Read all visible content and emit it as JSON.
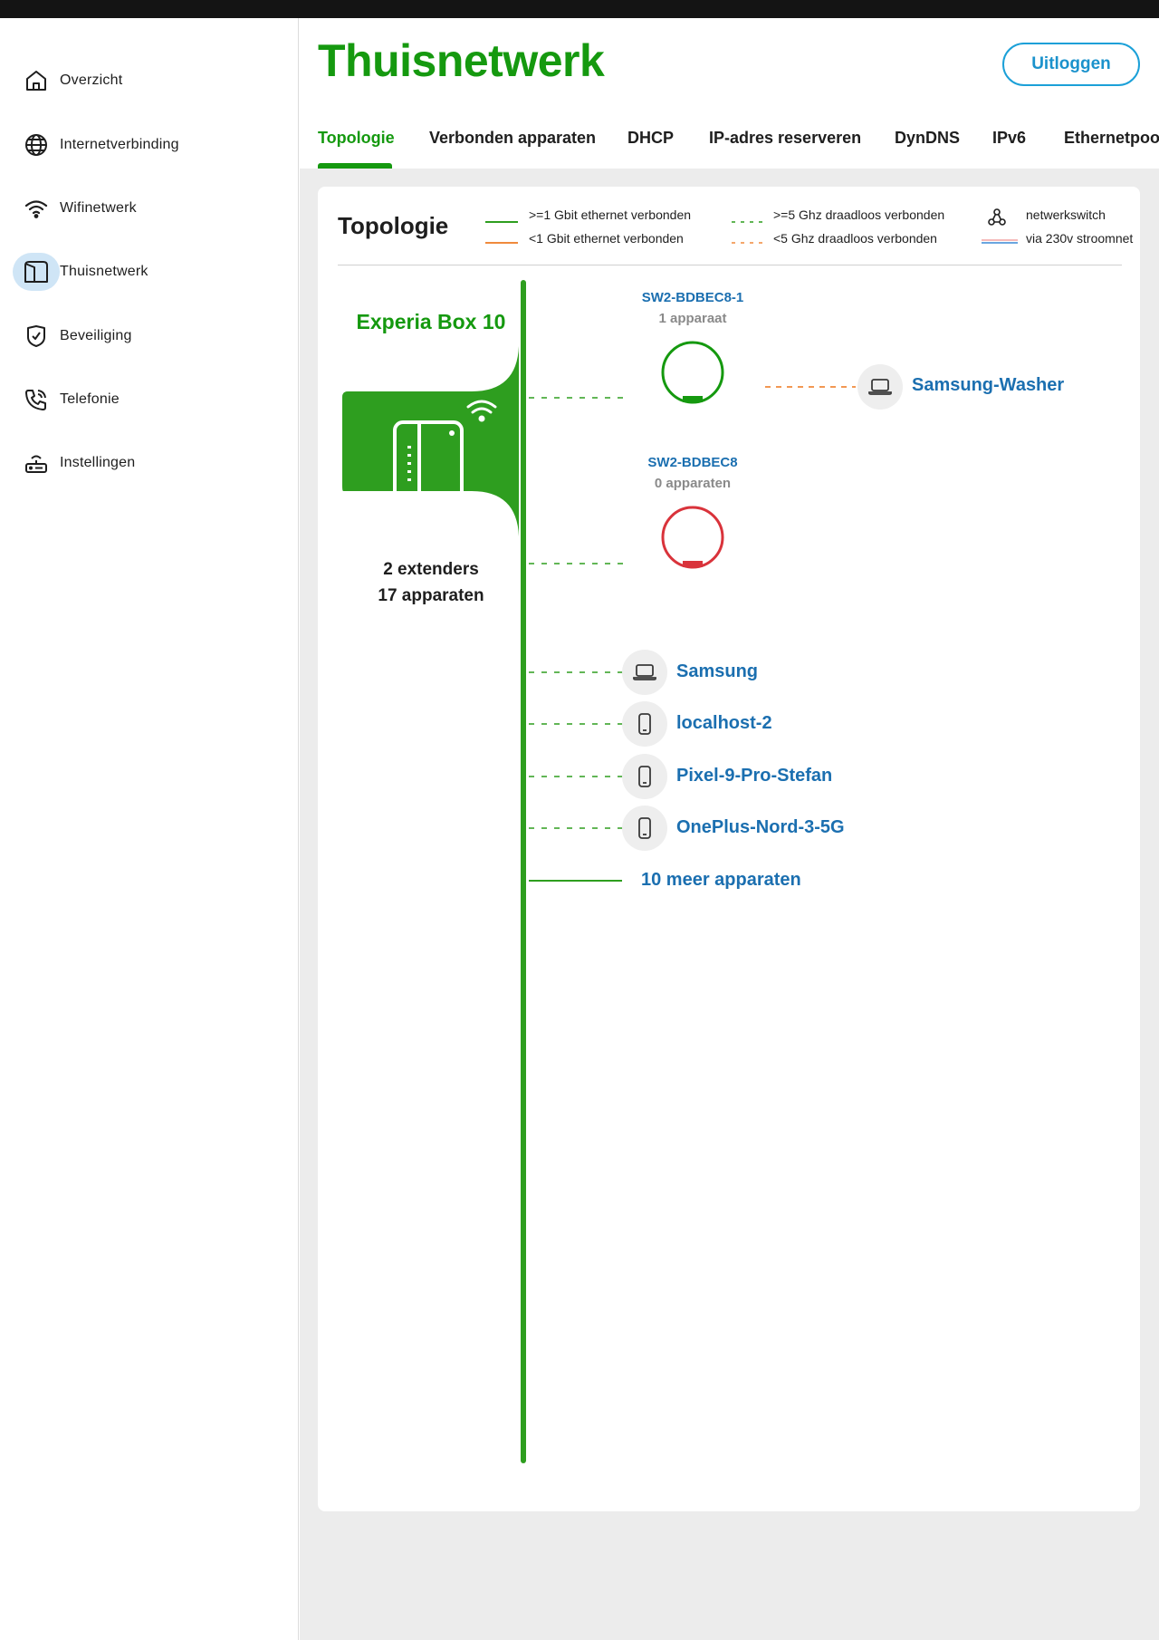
{
  "header": {
    "title": "Thuisnetwerk",
    "logout_label": "Uitloggen"
  },
  "sidebar": {
    "items": [
      {
        "label": "Overzicht",
        "icon": "home-icon"
      },
      {
        "label": "Internetverbinding",
        "icon": "globe-icon"
      },
      {
        "label": "Wifinetwerk",
        "icon": "wifi-icon"
      },
      {
        "label": "Thuisnetwerk",
        "icon": "home-network-icon",
        "active": true
      },
      {
        "label": "Beveiliging",
        "icon": "shield-icon"
      },
      {
        "label": "Telefonie",
        "icon": "phone-icon"
      },
      {
        "label": "Instellingen",
        "icon": "router-icon"
      }
    ]
  },
  "tabs": [
    {
      "label": "Topologie",
      "active": true
    },
    {
      "label": "Verbonden apparaten"
    },
    {
      "label": "DHCP"
    },
    {
      "label": "IP-adres reserveren"
    },
    {
      "label": "DynDNS"
    },
    {
      "label": "IPv6"
    },
    {
      "label": "Ethernetpoorten"
    }
  ],
  "topology": {
    "title": "Topologie",
    "legend": {
      "gbit_eth": ">=1 Gbit ethernet verbonden",
      "sub_gbit_eth": "<1 Gbit ethernet verbonden",
      "wifi_5ghz": ">=5 Ghz draadloos verbonden",
      "wifi_sub_5ghz": "<5 Ghz draadloos verbonden",
      "switch": "netwerkswitch",
      "powerline": "via 230v stroomnet"
    },
    "box": {
      "name": "Experia Box 10",
      "extenders": "2 extenders",
      "devices": "17 apparaten"
    },
    "extenders": [
      {
        "name": "SW2-BDBEC8-1",
        "count": "1 apparaat",
        "status": "online",
        "child": "Samsung-Washer"
      },
      {
        "name": "SW2-BDBEC8",
        "count": "0 apparaten",
        "status": "offline"
      }
    ],
    "devices": [
      {
        "name": "Samsung",
        "type": "laptop-icon"
      },
      {
        "name": "localhost-2",
        "type": "phone-device-icon"
      },
      {
        "name": "Pixel-9-Pro-Stefan",
        "type": "phone-device-icon"
      },
      {
        "name": "OnePlus-Nord-3-5G",
        "type": "phone-device-icon"
      }
    ],
    "more_devices": "10 meer apparaten"
  },
  "colors": {
    "brand_green": "#15990f",
    "link_blue": "#1b6fb0",
    "offline_red": "#d9333b",
    "orange": "#f08a3c",
    "accent_blue": "#1ba0d8"
  }
}
